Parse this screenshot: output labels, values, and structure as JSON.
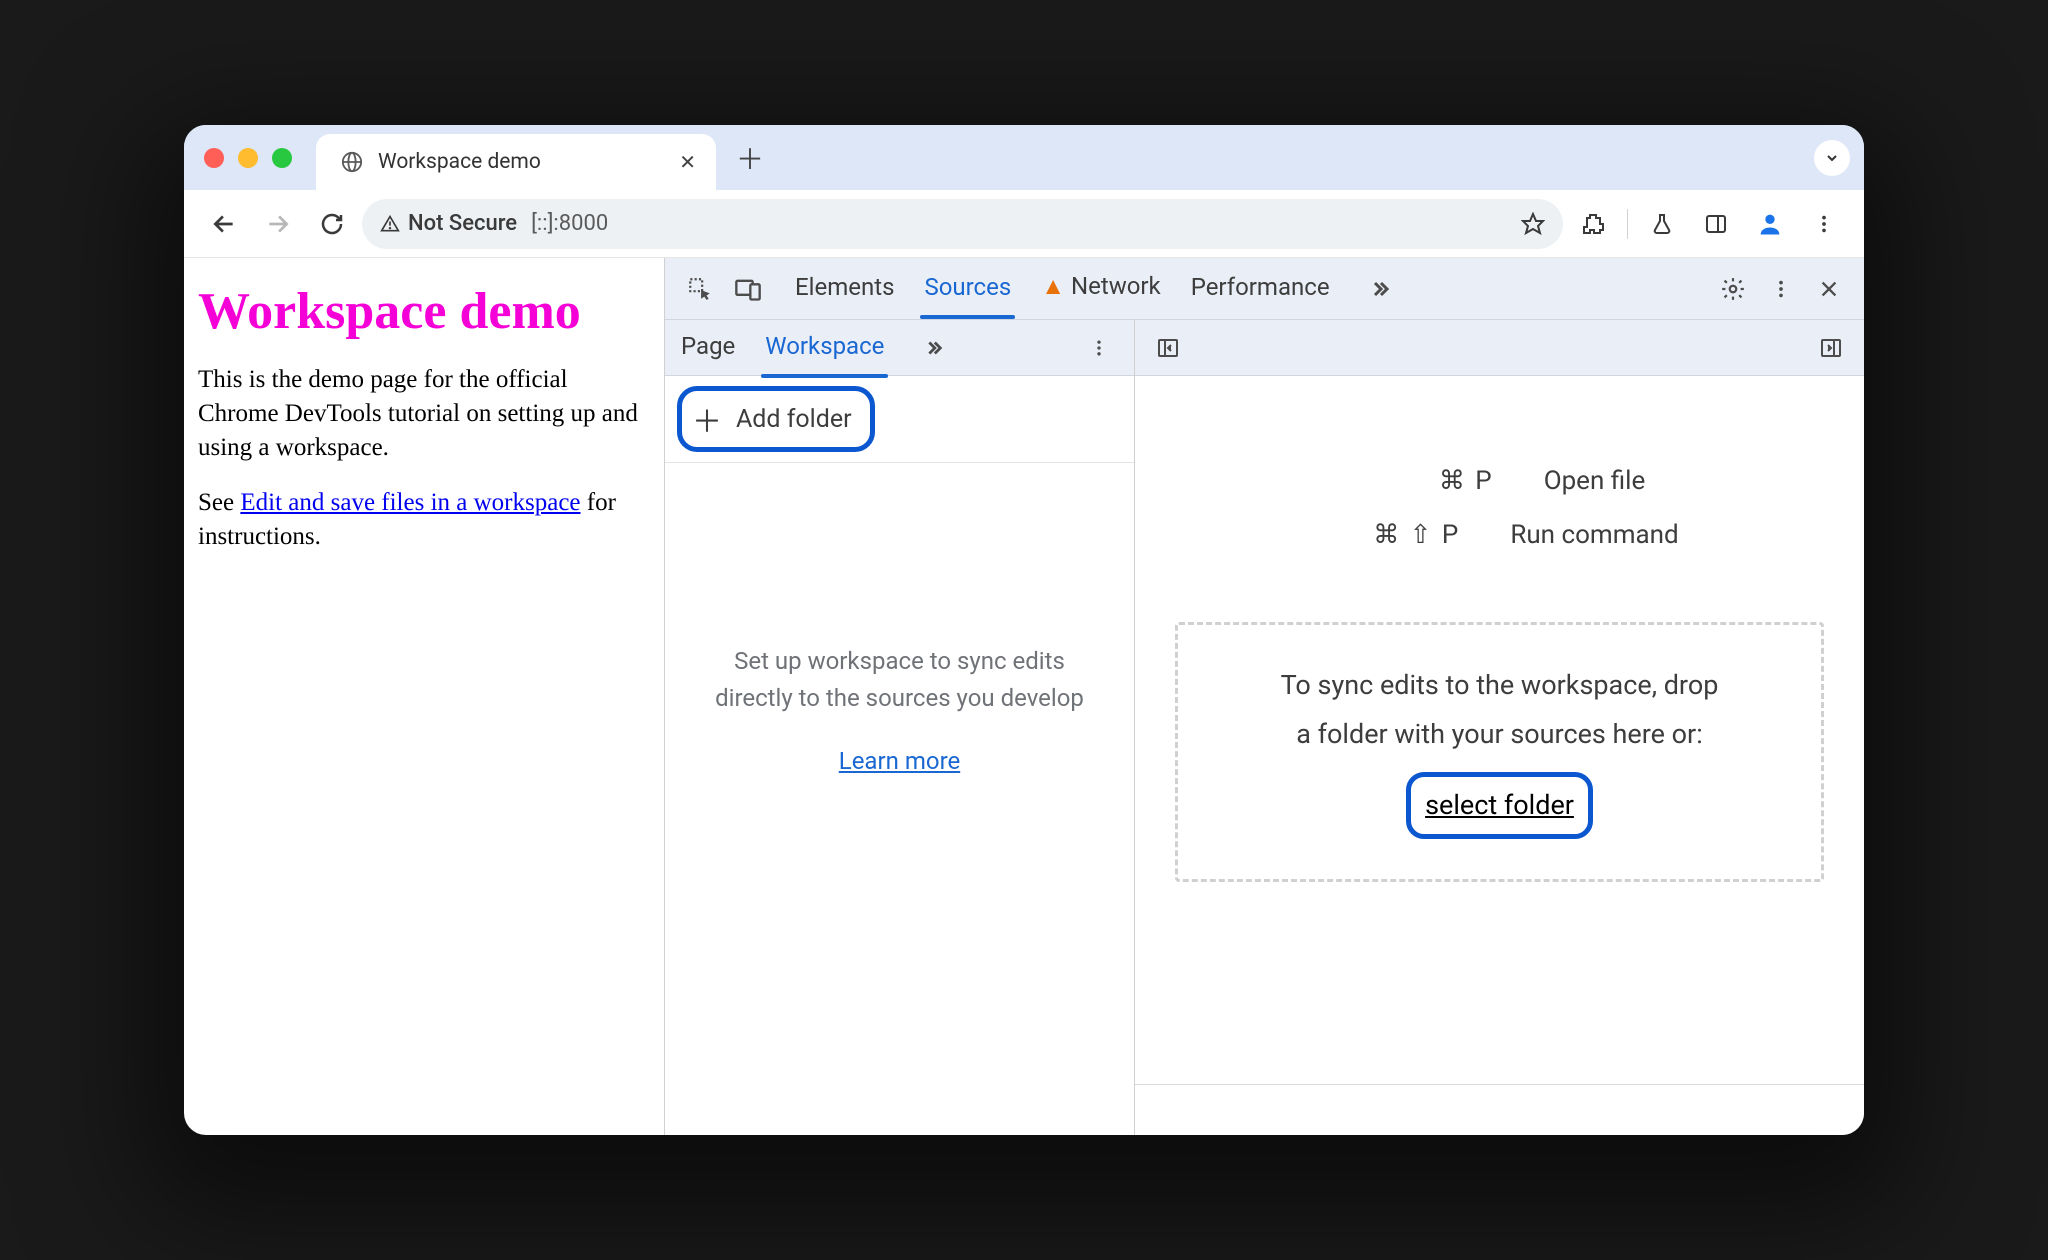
{
  "tab": {
    "title": "Workspace demo"
  },
  "omnibox": {
    "security": "Not Secure",
    "address": "[::]:8000"
  },
  "page": {
    "heading": "Workspace demo",
    "p1": "This is the demo page for the official Chrome DevTools tutorial on setting up and using a workspace.",
    "p2_prefix": "See ",
    "p2_link": "Edit and save files in a workspace",
    "p2_suffix": " for instructions."
  },
  "devtools": {
    "tabs": {
      "elements": "Elements",
      "sources": "Sources",
      "network": "Network",
      "performance": "Performance"
    },
    "left_tabs": {
      "page": "Page",
      "workspace": "Workspace"
    },
    "add_folder": "Add folder",
    "ws_hint": "Set up workspace to sync edits directly to the sources you develop",
    "learn_more": "Learn more",
    "shortcuts": {
      "open_keys": "⌘ P",
      "open_label": "Open file",
      "run_keys": "⌘ ⇧ P",
      "run_label": "Run command"
    },
    "dropzone": {
      "line1": "To sync edits to the workspace, drop",
      "line2": "a folder with your sources here or:",
      "select": "select folder"
    }
  }
}
